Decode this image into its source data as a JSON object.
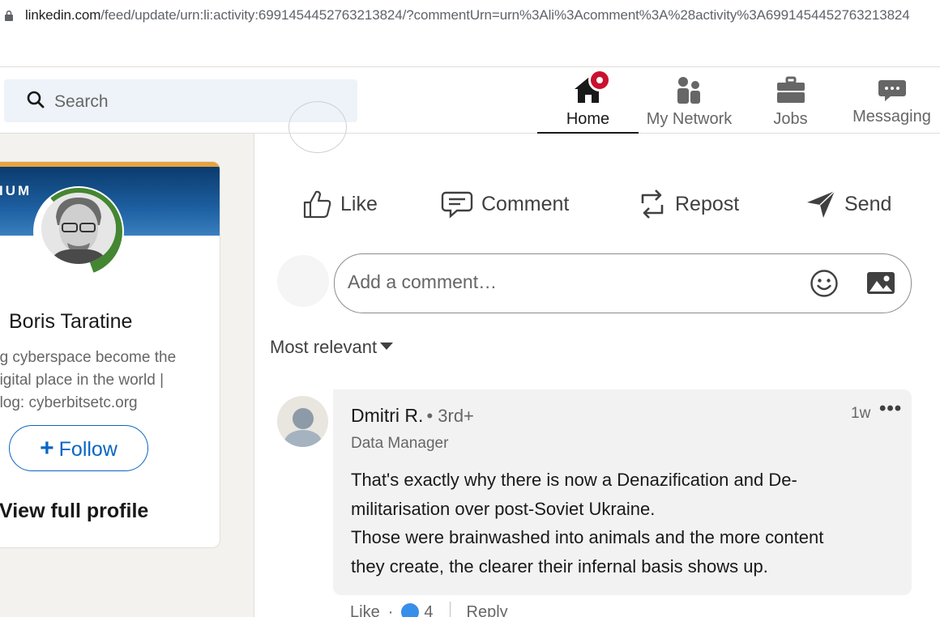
{
  "browser": {
    "url_host": "linkedin.com",
    "url_path": "/feed/update/urn:li:activity:6991454452763213824/?commentUrn=urn%3Ali%3Acomment%3A%28activity%3A6991454452763213824"
  },
  "header": {
    "search_placeholder": "Search",
    "nav": [
      {
        "label": "Home",
        "icon": "home-icon"
      },
      {
        "label": "My Network",
        "icon": "network-icon"
      },
      {
        "label": "Jobs",
        "icon": "briefcase-icon"
      },
      {
        "label": "Messaging",
        "icon": "messaging-icon"
      }
    ]
  },
  "profile_card": {
    "banner_text": "IUM",
    "avatar_badge": "#OPENTOWORK",
    "name": "Boris Taratine",
    "bio_lines": [
      "ng cyberspace become the",
      " digital place in the world |",
      "blog: cyberbitsetc.org"
    ],
    "follow_label": "Follow",
    "view_profile_label": "View full profile"
  },
  "post_actions": {
    "like": "Like",
    "comment": "Comment",
    "repost": "Repost",
    "send": "Send"
  },
  "comment_input": {
    "placeholder": "Add a comment…"
  },
  "sort": {
    "label": "Most relevant"
  },
  "comment": {
    "author": "Dmitri R.",
    "degree": "• 3rd+",
    "headline": "Data Manager",
    "time": "1w",
    "more": "•••",
    "text_lines": [
      "That's exactly why there is now a Denazification and De-",
      "militarisation over post-Soviet Ukraine.",
      "Those were brainwashed into animals and the more content",
      "they create, the clearer their infernal basis shows up."
    ],
    "like_label": "Like",
    "reaction_count": "4",
    "reply_label": "Reply"
  },
  "colors": {
    "linkedin_blue": "#0a66c2",
    "notification_red": "#cb112d",
    "open_to_work_green": "#448631"
  }
}
